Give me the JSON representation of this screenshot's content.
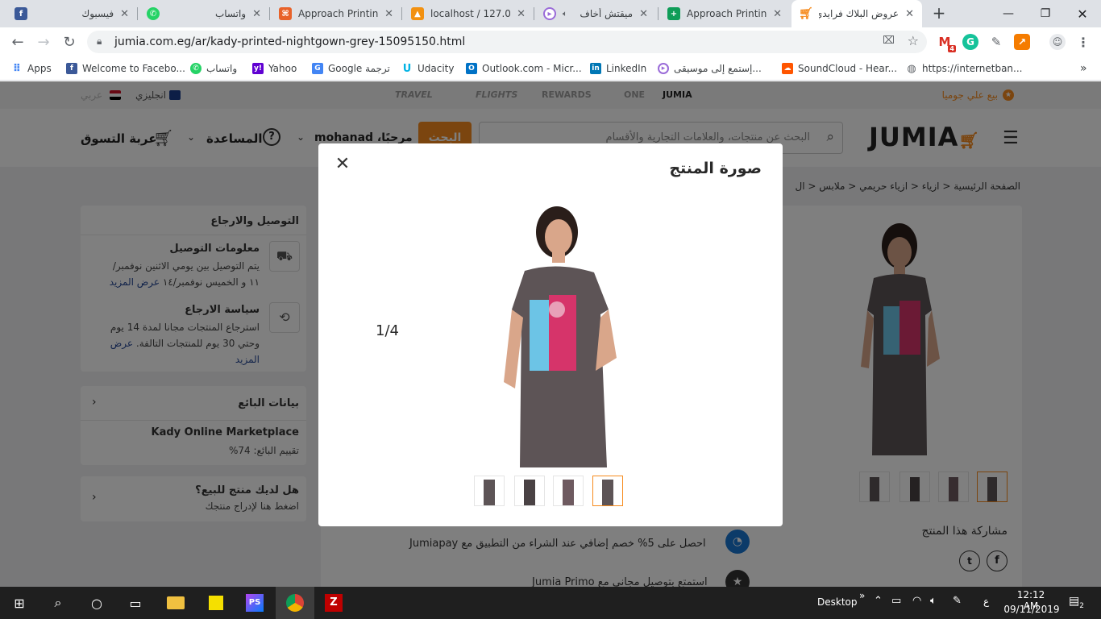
{
  "tabs": [
    {
      "title": "فيسبوك",
      "icon": "facebook-icon",
      "color": "#3b5998"
    },
    {
      "title": "واتساب",
      "icon": "whatsapp-icon",
      "color": "#25d366"
    },
    {
      "title": "Approach Printing",
      "icon": "approach-icon",
      "color": "#e8622a"
    },
    {
      "title": "localhost / 127.0.0.",
      "icon": "phpmyadmin-icon",
      "color": "#f29111"
    },
    {
      "title": "ميقتش أخاف",
      "icon": "music-icon",
      "color": "#9a6bd8"
    },
    {
      "title": "Approach Printing",
      "icon": "sheets-icon",
      "color": "#0f9d58"
    },
    {
      "title": "عروض البلاك فرايدي",
      "icon": "jumia-cart-icon",
      "color": "#f68b1e"
    }
  ],
  "address": {
    "url": "jumia.com.eg/ar/kady-printed-nightgown-grey-15095150.html"
  },
  "extensions": [
    {
      "icon": "gmail-icon",
      "badge": "4",
      "color": "#d93025"
    },
    {
      "icon": "grammarly-icon",
      "color": "#15c39a"
    },
    {
      "icon": "pen-icon",
      "color": "#5f6368"
    },
    {
      "icon": "chart-icon",
      "color": "#f57c00"
    }
  ],
  "bookmarks": [
    {
      "label": "Apps",
      "icon": "apps-icon",
      "color": "#4285f4"
    },
    {
      "label": "Welcome to Facebo...",
      "icon": "facebook-icon",
      "color": "#3b5998"
    },
    {
      "label": "واتساب",
      "icon": "whatsapp-icon",
      "color": "#25d366"
    },
    {
      "label": "Yahoo",
      "icon": "yahoo-icon",
      "color": "#6001d2"
    },
    {
      "label": "Google ترجمة",
      "icon": "translate-icon",
      "color": "#4285f4"
    },
    {
      "label": "Udacity",
      "icon": "udacity-icon",
      "color": "#02b3e4"
    },
    {
      "label": "Outlook.com - Micr...",
      "icon": "outlook-icon",
      "color": "#0072c6"
    },
    {
      "label": "LinkedIn",
      "icon": "linkedin-icon",
      "color": "#0077b5"
    },
    {
      "label": "إستمع إلى موسيقى...",
      "icon": "music-icon",
      "color": "#9a6bd8"
    },
    {
      "label": "SoundCloud - Hear...",
      "icon": "soundcloud-icon",
      "color": "#ff5500"
    },
    {
      "label": "https://internetban...",
      "icon": "globe-icon",
      "color": "#5f6368"
    }
  ],
  "site": {
    "sell_link": "بيع علي جوميا",
    "services": [
      "TRAVEL",
      "FLIGHTS",
      "REWARDS",
      "ONE",
      "JUMIA"
    ],
    "lang_en": "انجليزي",
    "lang_ar": "عربي",
    "logo": "JUMIA",
    "search_placeholder": "البحث عن منتجات، والعلامات التجارية والأقسام",
    "search_button": "البحث",
    "greeting": "مرحبًا، mohanad",
    "help": "المساعدة",
    "cart": "عربة التسوق"
  },
  "breadcrumb": [
    "الصفحة الرئيسية",
    "ازياء",
    "ازياء حريمي",
    "ملابس",
    "ال"
  ],
  "delivery": {
    "title": "التوصيل والارجاع",
    "info_title": "معلومات التوصيل",
    "info_text_1": "يتم التوصيل بين يومي الاثنين نوفمبر/",
    "info_text_2": "١١ و الخميس نوفمبر/١٤",
    "info_more": "عرض المزيد",
    "return_title": "سياسة الارجاع",
    "return_text_1": "استرجاع المنتجات مجانا لمدة 14 يوم",
    "return_text_2": "وحتي 30 يوم للمنتجات التالفة.",
    "return_more_1": "عرض",
    "return_more_2": "المزيد"
  },
  "seller": {
    "title": "بيانات البائع",
    "name": "Kady Online Marketplace",
    "rating": "تقييم البائع: 74%"
  },
  "sell_card": {
    "title": "هل لديك منتج للبيع؟",
    "subtitle": "اضغط هنا لإدراج منتجك"
  },
  "share": {
    "title": "مشاركة هذا المنتج"
  },
  "promos": [
    {
      "text": "احصل على 5% خصم إضافي عند الشراء من التطبيق مع Jumiapay"
    },
    {
      "text": "استمتع بتوصيل مجاني مع Jumia Primo"
    }
  ],
  "modal": {
    "title": "صورة المنتج",
    "counter": "1/4",
    "thumbnails": 4,
    "selected_thumbnail": 4
  },
  "taskbar": {
    "desktop": "Desktop",
    "lang": "ع",
    "time": "12:12 AM",
    "date": "09/11/2019",
    "notifications": "2"
  }
}
